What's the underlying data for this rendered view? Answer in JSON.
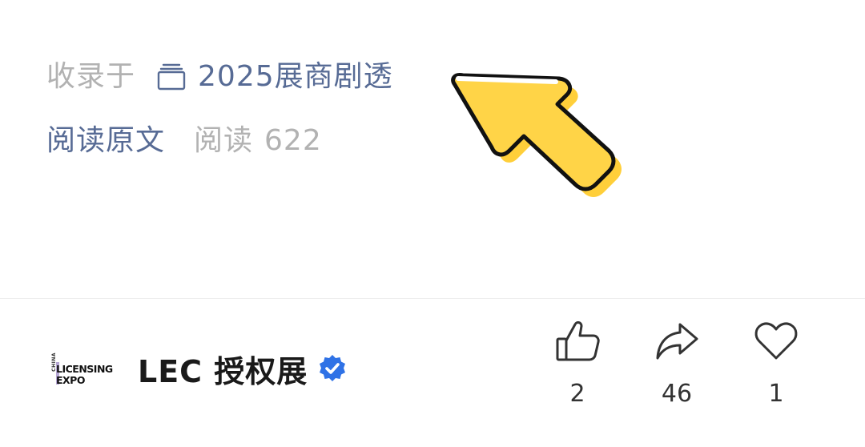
{
  "article_footer": {
    "collected_prefix": "收录于",
    "collection": {
      "icon": "collection-stack-icon",
      "name": "2025展商剧透"
    },
    "read_original_label": "阅读原文",
    "read_label": "阅读",
    "read_count": "622"
  },
  "account": {
    "logo": {
      "china": "CHINA",
      "line1": "LICENSING",
      "line2": "EXPO"
    },
    "name": "LEC 授权展",
    "verified": true,
    "verified_color": "#2f72e6"
  },
  "actions": {
    "like": {
      "icon": "thumbs-up-icon",
      "count": "2"
    },
    "share": {
      "icon": "share-arrow-icon",
      "count": "46"
    },
    "favorite": {
      "icon": "heart-icon",
      "count": "1"
    }
  },
  "colors": {
    "link": "#576b95",
    "muted": "#b2b2b2",
    "pointer_fill": "#ffcf3a",
    "pointer_stroke": "#111111"
  }
}
